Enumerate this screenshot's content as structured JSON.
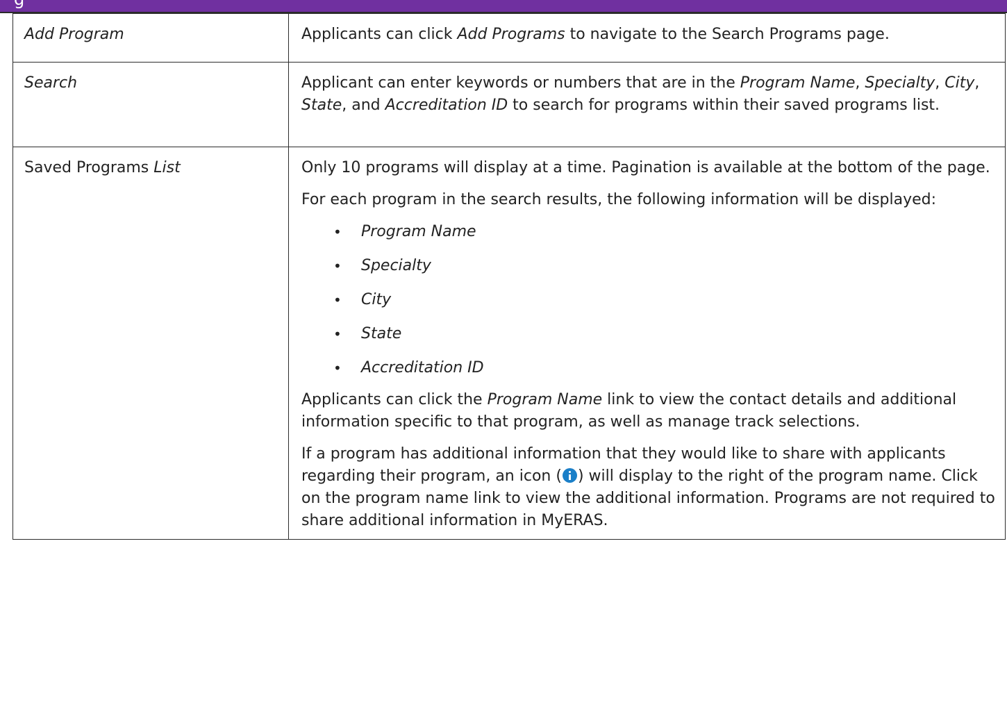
{
  "header": {
    "title_fragment": "g"
  },
  "rows": {
    "add_program": {
      "term": "Add Program",
      "desc": {
        "t1": "Applicants can click ",
        "i1": "Add Programs",
        "t2": " to navigate to the Search Programs page."
      }
    },
    "search": {
      "term": "Search",
      "desc": {
        "t1": "Applicant can enter keywords or numbers that are in the ",
        "i1": "Program Name",
        "t2": ", ",
        "i2": "Specialty",
        "t3": ", ",
        "i3": "City",
        "t4": ", ",
        "i4": "State",
        "t5": ", and ",
        "i5": "Accreditation ID",
        "t6": " to search for programs within their saved programs list."
      }
    },
    "saved_programs": {
      "term_plain": "Saved Programs ",
      "term_italic": "List",
      "p1": "Only 10 programs will display at a time. Pagination is available at the bottom of the page.",
      "p2": "For each program in the search results, the following information will be displayed:",
      "bullet_glyph": "•",
      "fields": [
        "Program Name",
        "Specialty",
        "City",
        "State",
        "Accreditation ID"
      ],
      "p3": {
        "t1": "Applicants can click the ",
        "i1": "Program Name",
        "t2": " link to view the contact details and additional information specific to that program, as well as manage track selections."
      },
      "p4": {
        "t1": "If a program has additional information that they would like to share with applicants regarding their program, an icon (",
        "icon": "info-icon",
        "t2": ") will display to the right of the program name. Click on the program name link to view the additional information. Programs are not required to share additional information in MyERAS."
      }
    }
  },
  "colors": {
    "header_bg": "#7030a0",
    "info_icon": "#1a7fc8",
    "border": "#2b2b2b"
  }
}
